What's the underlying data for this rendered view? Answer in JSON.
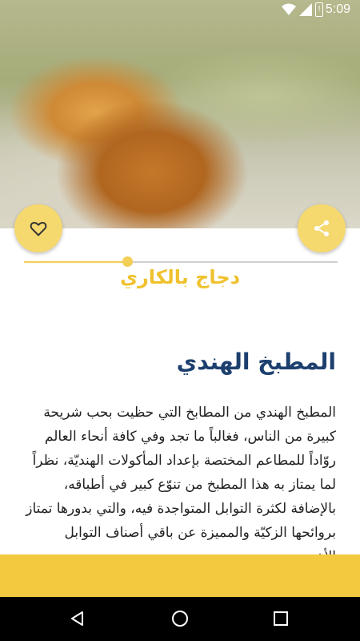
{
  "status_bar": {
    "time": "5:09",
    "battery_label": "!"
  },
  "hero": {
    "icons": {
      "favorite": "heart-outline-icon",
      "share": "share-icon"
    }
  },
  "recipe": {
    "title": "دجاج بالكاري",
    "reading_progress": 0.33
  },
  "article": {
    "heading": "المطبخ الهندي",
    "body": "المطبخ الهندي من المطابخ التي حظيت بحب شريحة كبيرة من الناس، فغالباً ما تجد وفي كافة أنحاء العالم روّاداً للمطاعم المختصة بإعداد المأكولات الهنديّة، نظراً لما يمتاز به هذا المطبخ من تنوّع كبير في أطباقه، بالإضافة لكثرة التوابل المتواجدة فيه، والتي بدورها تمتاز بروائحها الزكيّة والمميزة عن باقي أصناف التوابل الأخرى"
  },
  "colors": {
    "accent": "#F3CA3F",
    "fab": "#F5D96E",
    "heading": "#1C3F6E",
    "title": "#EFC22E"
  },
  "nav_bar": {
    "icons": [
      "back-triangle-icon",
      "home-circle-icon",
      "recents-square-icon"
    ]
  }
}
